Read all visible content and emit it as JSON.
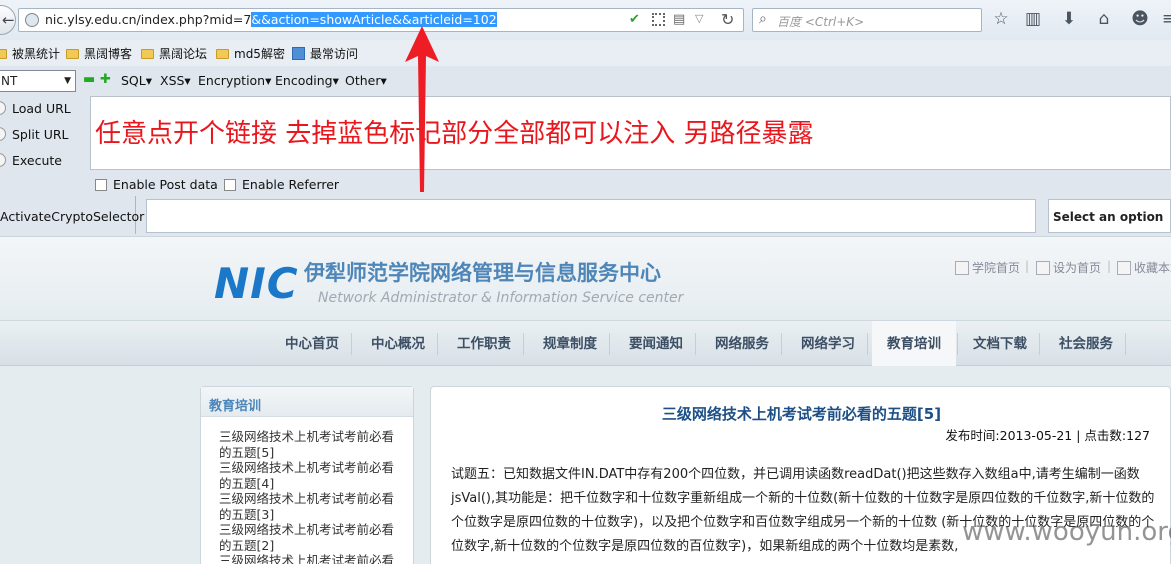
{
  "browser": {
    "url_plain": "nic.ylsy.edu.cn/index.php?mid=7",
    "url_selected": "&&action=showArticle&&articleid=102",
    "search_placeholder": "百度 <Ctrl+K>"
  },
  "bookmarks": [
    {
      "label": "被黑统计",
      "icon": "folder-icon"
    },
    {
      "label": "黑阔博客",
      "icon": "folder-icon"
    },
    {
      "label": "黑阔论坛",
      "icon": "folder-icon"
    },
    {
      "label": "md5解密",
      "icon": "folder-icon"
    },
    {
      "label": "最常访问",
      "icon": "bookmark-icon"
    }
  ],
  "hackbar": {
    "select_value": "NT",
    "menus": [
      "SQL▾",
      "XSS▾",
      "Encryption▾",
      "Encoding▾",
      "Other▾"
    ],
    "side_buttons": [
      "Load URL",
      "Split URL",
      "Execute"
    ],
    "textarea_text": "任意点开个链接 去掉蓝色标记部分全部都可以注入 另路径暴露",
    "checks": [
      "Enable Post data",
      "Enable Referrer"
    ],
    "crypto_label": "ActivateCryptoSelector",
    "select_option": "Select an option"
  },
  "site": {
    "logo": "NIC",
    "title": "伊犁师范学院网络管理与信息服务中心",
    "subtitle": "Network Administrator & Information  Service center",
    "top_links": [
      "学院首页",
      "设为首页",
      "收藏本站"
    ],
    "nav": [
      "中心首页",
      "中心概况",
      "工作职责",
      "规章制度",
      "要闻通知",
      "网络服务",
      "网络学习",
      "教育培训",
      "文档下载",
      "社会服务"
    ],
    "active_nav": "教育培训",
    "sidebar_title": "教育培训",
    "sidebar_items": [
      "三级网络技术上机考试考前必看的五题[5]",
      "三级网络技术上机考试考前必看的五题[4]",
      "三级网络技术上机考试考前必看的五题[3]",
      "三级网络技术上机考试考前必看的五题[2]",
      "三级网络技术上机考试考前必看的"
    ],
    "article_title": "三级网络技术上机考试考前必看的五题[5]",
    "article_meta": "发布时间:2013-05-21 | 点击数:127",
    "article_body": "试题五：已知数据文件IN.DAT中存有200个四位数，并已调用读函数readDat()把这些数存入数组a中,请考生编制一函数jsVal(),其功能是：把千位数字和十位数字重新组成一个新的十位数(新十位数的十位数字是原四位数的千位数字,新十位数的个位数字是原四位数的十位数字)，以及把个位数字和百位数字组成另一个新的十位数 (新十位数的十位数字是原四位数的个位数字,新十位数的个位数字是原四位数的百位数字)，如果新组成的两个十位数均是素数,"
  },
  "watermark": "www.wooyun.org",
  "colors": {
    "annotation_red": "#e8171d",
    "selection_blue": "#3399ff",
    "logo_blue": "#1b77c7"
  }
}
